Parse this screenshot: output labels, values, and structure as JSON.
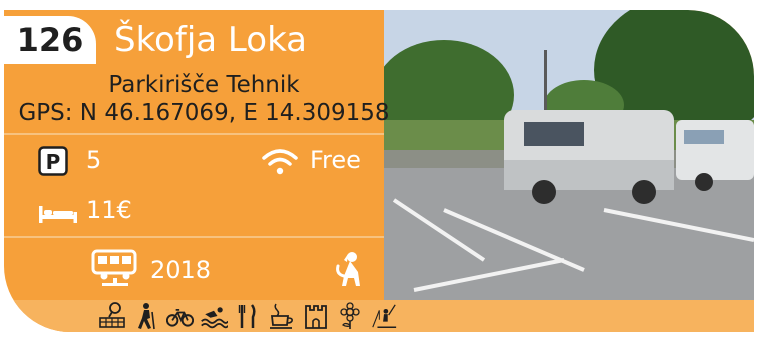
{
  "card": {
    "number": "126",
    "city": "Škofja Loka",
    "place_name": "Parkirišče Tehnik",
    "gps": "GPS: N 46.167069, E 14.309158",
    "parking_spots": "5",
    "wifi": "Free",
    "price": "11€",
    "year": "2018"
  },
  "icons": {
    "parking": "parking-icon",
    "wifi": "wifi-icon",
    "bed": "bed-icon",
    "campervan": "campervan-icon",
    "dog": "dog-icon",
    "amenities": [
      "tennis-icon",
      "hiking-icon",
      "cycling-icon",
      "swimming-icon",
      "restaurant-icon",
      "cafe-icon",
      "castle-icon",
      "flower-icon",
      "fishing-icon"
    ]
  },
  "colors": {
    "card_orange": "#f6a03a",
    "strip_orange": "#f7b35e",
    "text_dark": "#1f1f1f",
    "text_white": "#ffffff"
  }
}
